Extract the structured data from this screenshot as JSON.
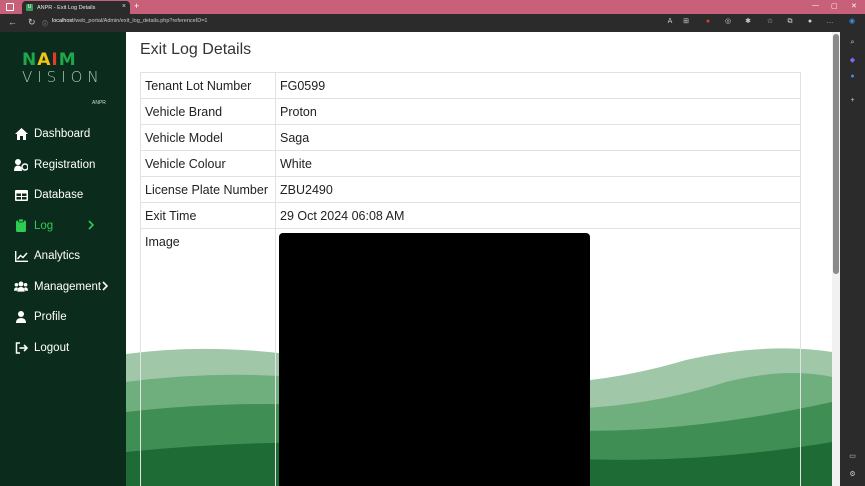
{
  "browser": {
    "tab_title": "ANPR - Exit Log Details",
    "url_host": "localhost",
    "url_path": "/web_portal/Admin/exit_log_details.php?referenceID=1",
    "new_tab": "+",
    "close": "×"
  },
  "sidebar": {
    "logo_letters": [
      "N",
      "A",
      "I",
      "M"
    ],
    "logo_sub": "VISION",
    "logo_tag": "ANPR",
    "items": [
      {
        "label": "Dashboard",
        "icon": "home-icon"
      },
      {
        "label": "Registration",
        "icon": "user-plus-icon"
      },
      {
        "label": "Database",
        "icon": "table-icon"
      },
      {
        "label": "Log",
        "icon": "clipboard-icon",
        "active": true
      },
      {
        "label": "Analytics",
        "icon": "chart-line-icon"
      },
      {
        "label": "Management",
        "icon": "users-icon"
      },
      {
        "label": "Profile",
        "icon": "user-icon"
      },
      {
        "label": "Logout",
        "icon": "logout-icon"
      }
    ]
  },
  "page": {
    "title": "Exit Log Details",
    "rows": [
      {
        "key": "Tenant Lot Number",
        "value": "FG0599"
      },
      {
        "key": "Vehicle Brand",
        "value": "Proton"
      },
      {
        "key": "Vehicle Model",
        "value": "Saga"
      },
      {
        "key": "Vehicle Colour",
        "value": "White"
      },
      {
        "key": "License Plate Number",
        "value": "ZBU2490"
      },
      {
        "key": "Exit Time",
        "value": "29 Oct 2024 06:08 AM"
      }
    ],
    "image_label": "Image"
  },
  "colors": {
    "sidebar_bg": "#0b2b1d",
    "accent_green": "#2ecc55",
    "titlebar": "#c8607a"
  }
}
